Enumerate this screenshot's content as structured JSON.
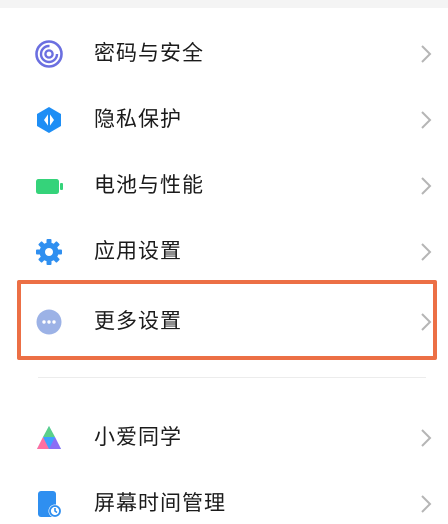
{
  "settings": {
    "items": [
      {
        "label": "密码与安全",
        "icon": "fingerprint-icon",
        "color": "#6b6fe0"
      },
      {
        "label": "隐私保护",
        "icon": "privacy-shield-icon",
        "color": "#1e8ef5"
      },
      {
        "label": "电池与性能",
        "icon": "battery-icon",
        "color": "#35d37a"
      },
      {
        "label": "应用设置",
        "icon": "gear-icon",
        "color": "#2f8ff0"
      },
      {
        "label": "更多设置",
        "icon": "more-icon",
        "color": "#9cb2e6"
      },
      {
        "label": "小爱同学",
        "icon": "xiaoai-icon",
        "color": "#3fa0ff"
      },
      {
        "label": "屏幕时间管理",
        "icon": "screen-time-icon",
        "color": "#2f8ff0"
      }
    ]
  },
  "highlight": {
    "target": "更多设置",
    "color": "#ec6f45"
  }
}
